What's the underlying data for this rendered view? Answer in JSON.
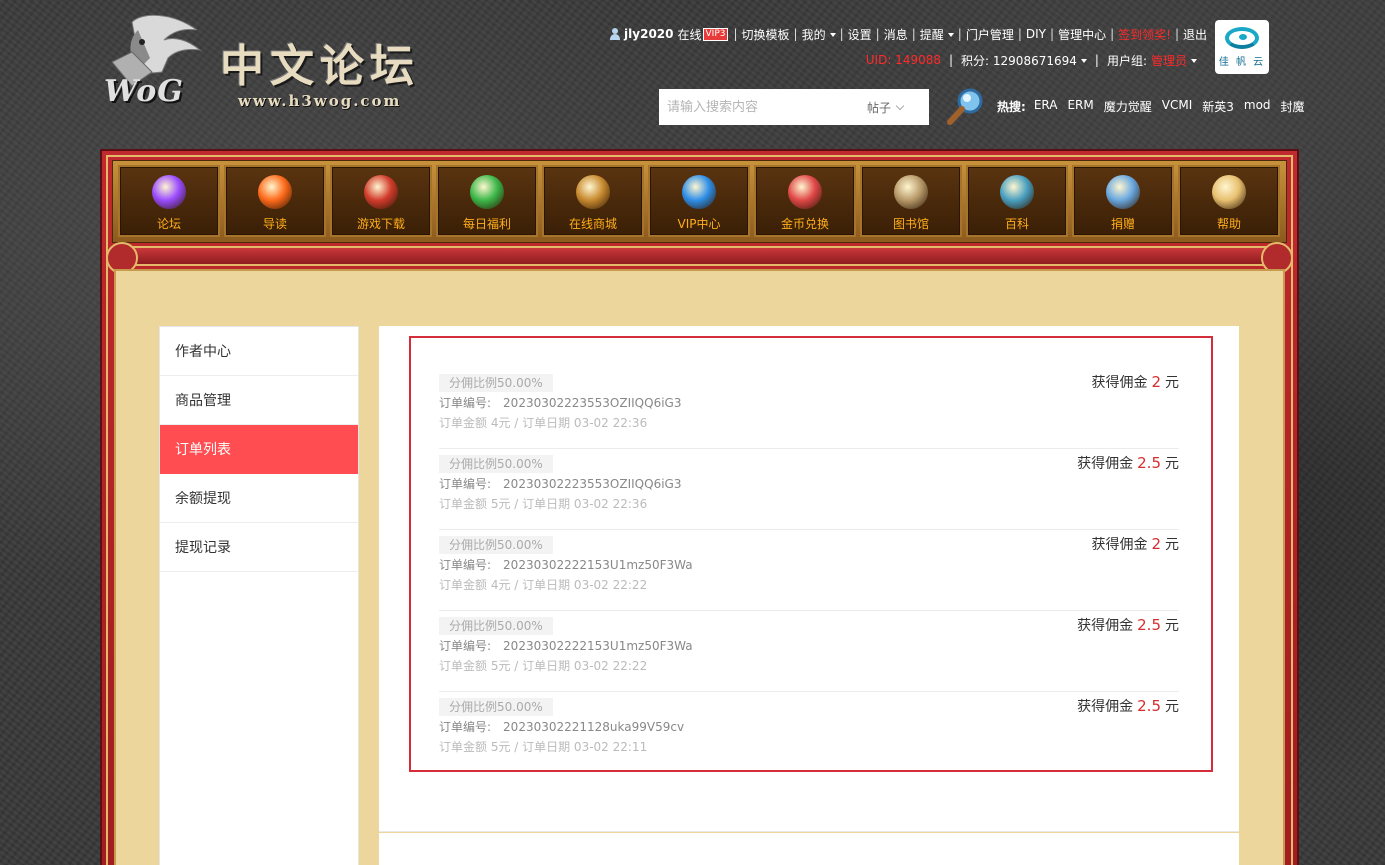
{
  "header": {
    "logo_title": "中文论坛",
    "logo_url": "www.h3wog.com",
    "logo_mark": "WoG",
    "user": {
      "name": "jly2020",
      "status": "在线",
      "vip_badge": "VIP3"
    },
    "top_links": [
      "切换模板",
      "我的",
      "设置",
      "消息",
      "提醒",
      "门户管理",
      "DIY",
      "管理中心",
      "签到领奖!",
      "退出"
    ],
    "uid_label": "UID: 149088",
    "points_label": "积分: 12908671694",
    "group_label": "用户组:",
    "group_value": "管理员",
    "cloud_text": "佳 帆 云",
    "search": {
      "placeholder": "请输入搜索内容",
      "scope": "帖子"
    },
    "hot": {
      "label": "热搜:",
      "items": [
        "ERA",
        "ERM",
        "魔力觉醒",
        "VCMI",
        "新英3",
        "mod",
        "封魔"
      ]
    }
  },
  "nav": {
    "items": [
      {
        "label": "论坛",
        "color": "#9b4cff"
      },
      {
        "label": "导读",
        "color": "#ff6a1a"
      },
      {
        "label": "游戏下载",
        "color": "#d23c2c"
      },
      {
        "label": "每日福利",
        "color": "#3db84a"
      },
      {
        "label": "在线商城",
        "color": "#c88a30"
      },
      {
        "label": "VIP中心",
        "color": "#2f8fe8"
      },
      {
        "label": "金币兑换",
        "color": "#e04848"
      },
      {
        "label": "图书馆",
        "color": "#b89a6a"
      },
      {
        "label": "百科",
        "color": "#4aa0c0"
      },
      {
        "label": "捐赠",
        "color": "#6aa8e0"
      },
      {
        "label": "帮助",
        "color": "#e8c070"
      }
    ]
  },
  "sidebar": {
    "items": [
      {
        "label": "作者中心",
        "active": false
      },
      {
        "label": "商品管理",
        "active": false
      },
      {
        "label": "订单列表",
        "active": true
      },
      {
        "label": "余额提现",
        "active": false
      },
      {
        "label": "提现记录",
        "active": false
      }
    ]
  },
  "orders": {
    "commission_prefix": "获得佣金",
    "commission_unit": "元",
    "order_no_label": "订单编号:",
    "list": [
      {
        "ratio": "分佣比例50.00%",
        "order_no": "20230302223553OZIIQQ6iG3",
        "meta": "订单金额 4元 / 订单日期 03-02 22:36",
        "commission": "2"
      },
      {
        "ratio": "分佣比例50.00%",
        "order_no": "20230302223553OZIIQQ6iG3",
        "meta": "订单金额 5元 / 订单日期 03-02 22:36",
        "commission": "2.5"
      },
      {
        "ratio": "分佣比例50.00%",
        "order_no": "20230302222153U1mz50F3Wa",
        "meta": "订单金额 4元 / 订单日期 03-02 22:22",
        "commission": "2"
      },
      {
        "ratio": "分佣比例50.00%",
        "order_no": "20230302222153U1mz50F3Wa",
        "meta": "订单金额 5元 / 订单日期 03-02 22:22",
        "commission": "2.5"
      },
      {
        "ratio": "分佣比例50.00%",
        "order_no": "20230302221128uka99V59cv",
        "meta": "订单金额 5元 / 订单日期 03-02 22:11",
        "commission": "2.5"
      }
    ]
  }
}
